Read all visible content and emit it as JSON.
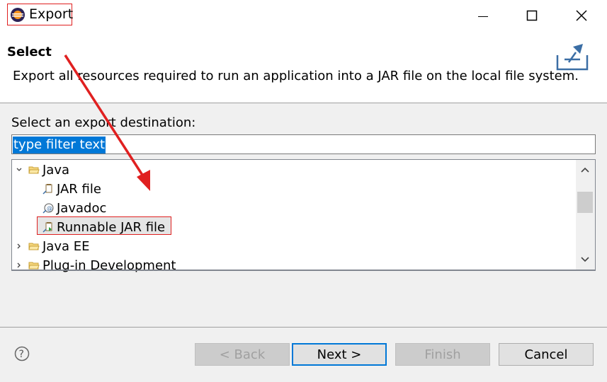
{
  "window": {
    "title": "Export",
    "controls": [
      "minimize-icon",
      "maximize-icon",
      "close-icon"
    ]
  },
  "header": {
    "heading": "Select",
    "description": "Export all resources required to run an application into a JAR file on the local file system.",
    "banner_icon": "export-icon"
  },
  "destination": {
    "label": "Select an export destination:",
    "filter_placeholder": "type filter text"
  },
  "tree": {
    "items": [
      {
        "label": "Java",
        "icon": "folder-open-icon",
        "expanded": true
      },
      {
        "label": "JAR file",
        "icon": "jar-icon"
      },
      {
        "label": "Javadoc",
        "icon": "javadoc-icon"
      },
      {
        "label": "Runnable JAR file",
        "icon": "runnable-jar-icon",
        "selected": true
      },
      {
        "label": "Java EE",
        "icon": "folder-icon",
        "expanded": false
      },
      {
        "label": "Plug-in Development",
        "icon": "folder-icon",
        "expanded": false
      }
    ]
  },
  "footer": {
    "help_icon": "help-icon",
    "back_label": "< Back",
    "next_label": "Next >",
    "finish_label": "Finish",
    "cancel_label": "Cancel"
  },
  "colors": {
    "highlight": "#e02020",
    "selection": "#0078d7"
  }
}
